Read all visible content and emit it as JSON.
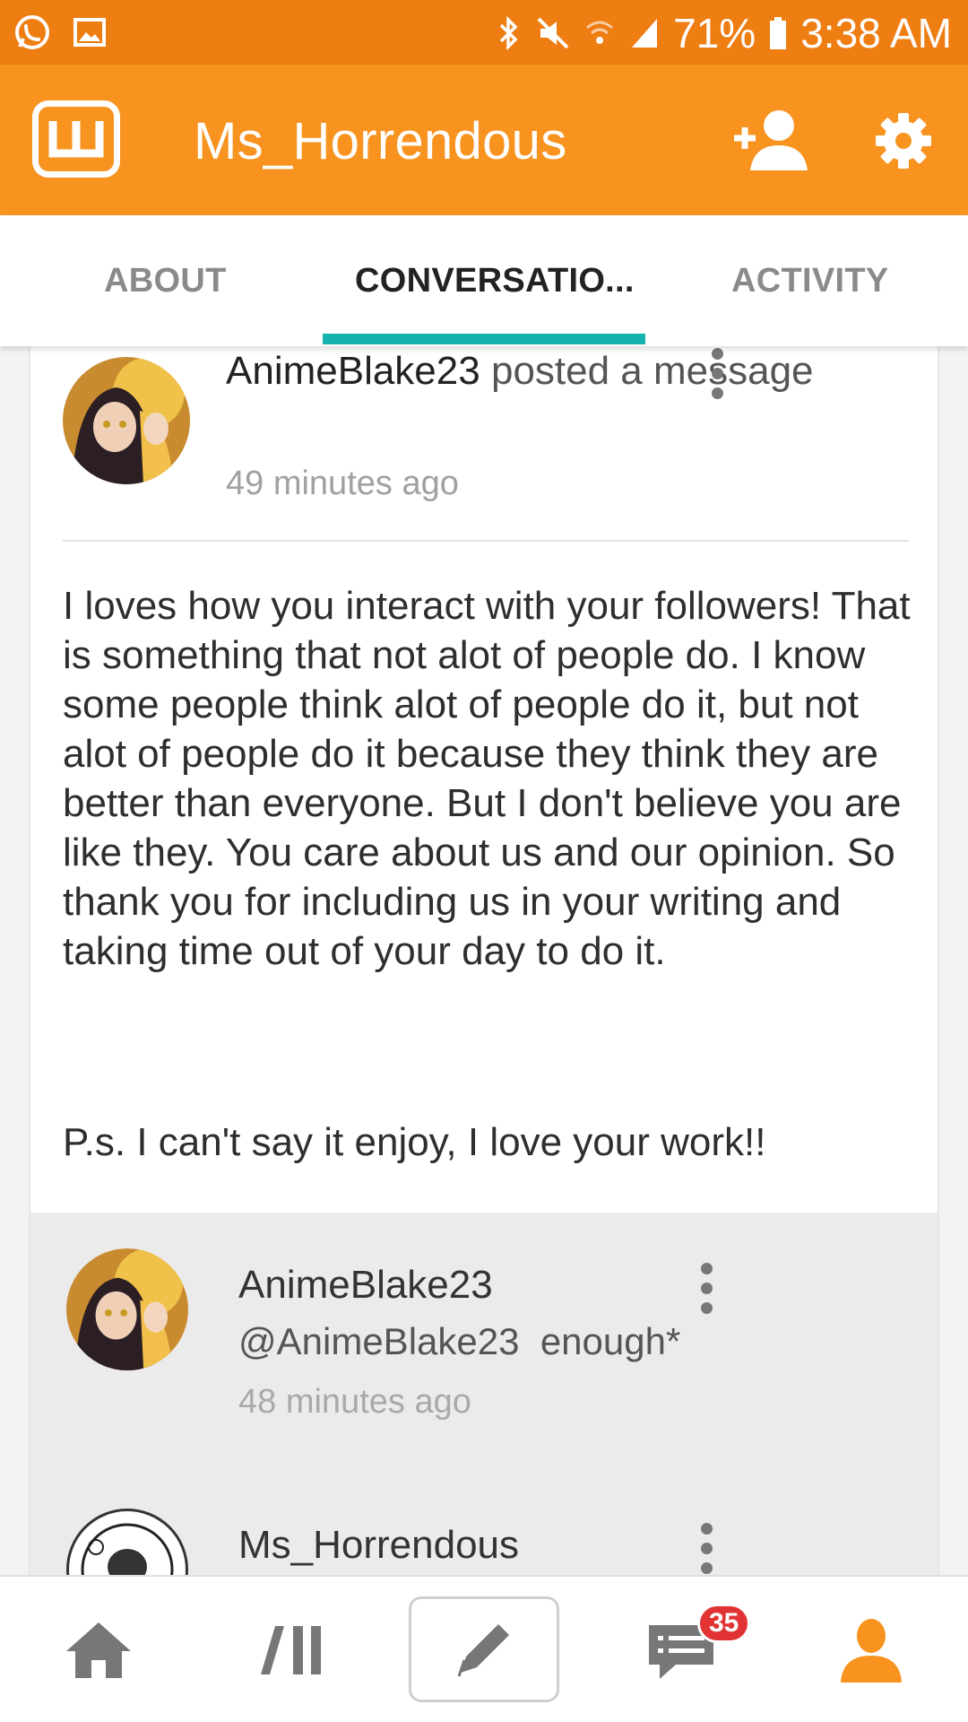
{
  "status_bar": {
    "battery": "71%",
    "time": "3:38 AM",
    "left_icons": [
      "whatsapp-icon",
      "gallery-icon"
    ],
    "right_icons": [
      "bluetooth-icon",
      "mute-icon",
      "wifi-icon",
      "signal-icon",
      "battery-icon"
    ]
  },
  "app_bar": {
    "title": "Ms_Horrendous",
    "logo_icon": "wattpad-logo-icon",
    "add_follow_icon": "add-user-icon",
    "settings_icon": "gear-icon",
    "background": "#f7931e"
  },
  "tabs": {
    "items": [
      {
        "label": "ABOUT",
        "active": false
      },
      {
        "label": "CONVERSATIO...",
        "active": true
      },
      {
        "label": "ACTIVITY",
        "active": false
      }
    ],
    "indicator_color": "#15b3ad"
  },
  "post": {
    "author": "AnimeBlake23",
    "action": "posted a message",
    "time": "49 minutes ago",
    "body": "I loves how you interact with your followers! That is something that not alot of people do. I know some people think alot of people do it, but not alot of people do it because they think they are better than everyone. But I don't believe you are like they. You care about us and our opinion. So thank you for including us in your writing and taking time out of your day to do it.",
    "ps": "P.s. I can't say it enjoy, I love your work!!"
  },
  "replies": [
    {
      "author": "AnimeBlake23",
      "mention": "@AnimeBlake23",
      "text": "enough*",
      "time": "48 minutes ago"
    },
    {
      "author": "Ms_Horrendous"
    }
  ],
  "bottom_nav": {
    "items": [
      "home-icon",
      "library-icon",
      "write-icon",
      "messages-icon",
      "profile-icon"
    ],
    "messages_badge": "35",
    "active_color": "#f7931e"
  }
}
